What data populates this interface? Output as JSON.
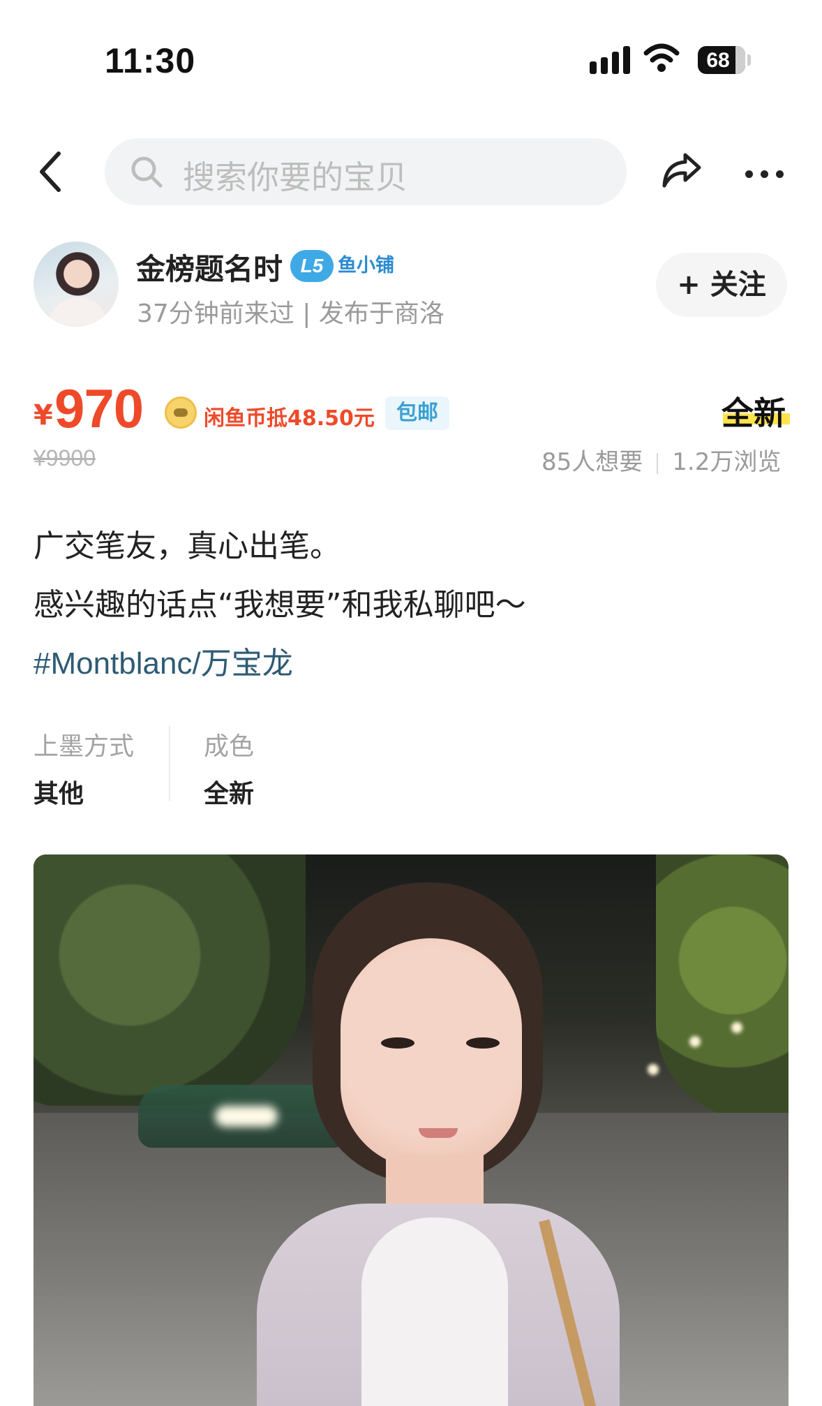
{
  "status_bar": {
    "time": "11:30",
    "battery": "68",
    "battery_level": 0.68
  },
  "nav": {
    "search_placeholder": "搜索你要的宝贝"
  },
  "seller": {
    "name": "金榜题名时",
    "badge_level": "L5",
    "badge_label": "鱼小铺",
    "meta": "37分钟前来过 | 发布于商洛",
    "follow_label": "+ 关注"
  },
  "price": {
    "currency": "¥",
    "value": "970",
    "coin_offer": "闲鱼币抵48.50元",
    "free_shipping": "包邮",
    "original": "¥9900",
    "condition": "全新",
    "wants": "85人想要",
    "views": "1.2万浏览"
  },
  "description": {
    "line1": "广交笔友，真心出笔。",
    "line2": "感兴趣的话点“我想要”和我私聊吧～",
    "tag": "#Montblanc/万宝龙"
  },
  "attributes": [
    {
      "label": "上墨方式",
      "value": "其他"
    },
    {
      "label": "成色",
      "value": "全新"
    }
  ],
  "colors": {
    "price": "#ee4a2a",
    "badge": "#3fa9e6",
    "highlight": "#ffe34d",
    "tag": "#2e5b73"
  },
  "icons": [
    "back-icon",
    "search-icon",
    "share-icon",
    "more-icon",
    "coin-icon",
    "signal-icon",
    "wifi-icon",
    "battery-icon"
  ]
}
